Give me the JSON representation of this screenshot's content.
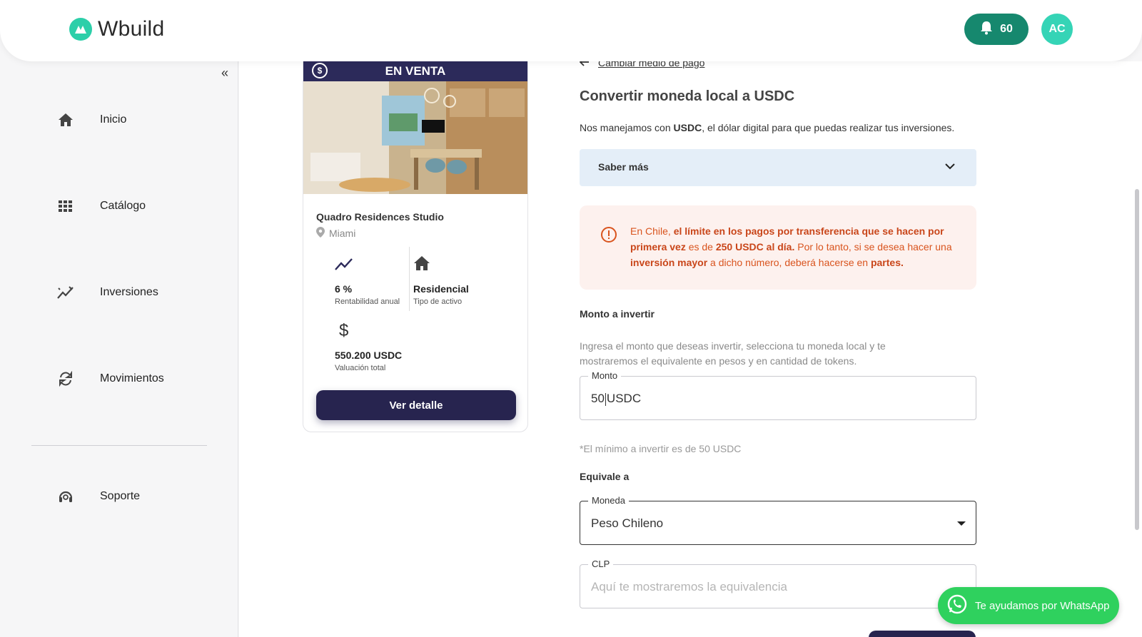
{
  "header": {
    "brand": "Wbuild",
    "notifications_count": "60",
    "avatar_initials": "AC"
  },
  "sidebar": {
    "collapse_label": "«",
    "items": [
      {
        "label": "Inicio",
        "icon": "home-icon"
      },
      {
        "label": "Catálogo",
        "icon": "grid-icon"
      },
      {
        "label": "Inversiones",
        "icon": "chart-icon"
      },
      {
        "label": "Movimientos",
        "icon": "swap-icon"
      },
      {
        "label": "Soporte",
        "icon": "headset-icon"
      }
    ]
  },
  "property": {
    "status": "EN VENTA",
    "name": "Quadro Residences Studio",
    "location": "Miami",
    "return_value": "6 %",
    "return_label": "Rentabilidad anual",
    "asset_value": "Residencial",
    "asset_label": "Tipo de activo",
    "valuation_value": "550.200 USDC",
    "valuation_label": "Valuación total",
    "detail_button": "Ver detalle"
  },
  "form": {
    "back_link": "Cambiar medio de pago",
    "title": "Convertir moneda local a USDC",
    "intro_pre": "Nos manejamos con ",
    "intro_bold": "USDC",
    "intro_post": ", el dólar digital para que puedas realizar tus inversiones.",
    "accordion_label": "Saber más",
    "alert": {
      "p1": "En Chile, ",
      "b1": "el límite en los pagos por transferencia que se hacen por primera vez",
      "p2": " es de ",
      "b2": "250 USDC al día.",
      "p3": " Por lo tanto, si se desea hacer una ",
      "b3": "inversión mayor",
      "p4": " a dicho número, deberá hacerse en ",
      "b4": "partes."
    },
    "amount_section": "Monto a invertir",
    "amount_help": "Ingresa el monto que deseas invertir, selecciona tu moneda local y te mostraremos el equivalente en pesos y en cantidad de tokens.",
    "amount_label": "Monto",
    "amount_value": "50",
    "amount_unit": "USDC",
    "minimum_note": "*El mínimo a invertir es de 50 USDC",
    "equivalent_section": "Equivale a",
    "currency_label": "Moneda",
    "currency_value": "Peso Chileno",
    "clp_label": "CLP",
    "clp_placeholder": "Aquí te mostraremos la equivalencia"
  },
  "whatsapp_label": "Te ayudamos por WhatsApp",
  "colors": {
    "brand_teal": "#2ccfa9",
    "notif_green": "#16886e",
    "navy": "#27244f",
    "alert_orange": "#d9541e",
    "whatsapp": "#2fd15e"
  }
}
